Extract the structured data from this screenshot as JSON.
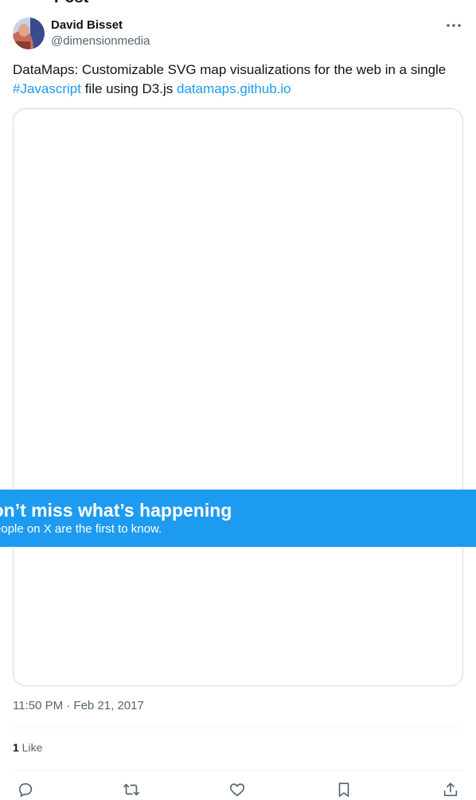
{
  "header": {
    "title_fragment": "Post"
  },
  "author": {
    "name": "David Bisset",
    "handle": "@dimensionmedia",
    "avatar_icon": "avatar-photo",
    "more_icon": "more-dots-icon"
  },
  "tweet": {
    "text_part1": "DataMaps: Customizable SVG map visualizations for the web in a single ",
    "hashtag": "#Javascript",
    "text_part2": " file using D3.js ",
    "link": "datamaps.github.io"
  },
  "banner": {
    "title": "Don’t miss what’s happening",
    "subtitle": "People on X are the first to know."
  },
  "meta": {
    "time": "11:50 PM · Feb 21, 2017"
  },
  "engagement": {
    "likes_count": "1",
    "likes_label": " Like"
  },
  "actions": [
    {
      "name": "reply",
      "icon": "reply-icon"
    },
    {
      "name": "repost",
      "icon": "repost-icon"
    },
    {
      "name": "like",
      "icon": "heart-icon"
    },
    {
      "name": "bookmark",
      "icon": "bookmark-icon"
    },
    {
      "name": "share",
      "icon": "share-icon"
    }
  ],
  "colors": {
    "accent": "#1d9bf0",
    "text": "#0f1419",
    "muted": "#536471",
    "border": "#cfd9de",
    "divider": "#eff3f4"
  }
}
